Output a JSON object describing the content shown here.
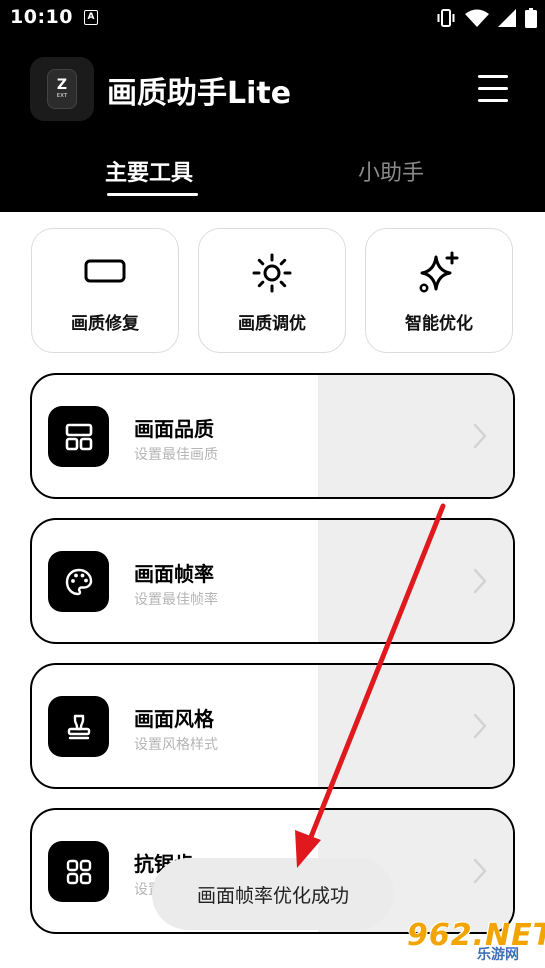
{
  "status_bar": {
    "time": "10:10",
    "notification_badge": "A",
    "icons": [
      "vibrate-icon",
      "wifi-icon",
      "signal-icon",
      "battery-icon"
    ]
  },
  "app": {
    "title": "画质助手Lite",
    "logo_letter": "Z",
    "logo_sub": "EXT"
  },
  "tabs": [
    {
      "label": "主要工具",
      "active": true
    },
    {
      "label": "小助手",
      "active": false
    }
  ],
  "quick_tools": [
    {
      "label": "画质修复",
      "icon": "rectangle-icon"
    },
    {
      "label": "画质调优",
      "icon": "sun-icon"
    },
    {
      "label": "智能优化",
      "icon": "sparkle-icon"
    }
  ],
  "features": [
    {
      "title": "画面品质",
      "subtitle": "设置最佳画质",
      "icon": "layout-grid-icon"
    },
    {
      "title": "画面帧率",
      "subtitle": "设置最佳帧率",
      "icon": "palette-icon"
    },
    {
      "title": "画面风格",
      "subtitle": "设置风格样式",
      "icon": "stamp-icon"
    },
    {
      "title": "抗锯齿",
      "subtitle": "设置抗锯齿",
      "icon": "apps-grid-icon"
    }
  ],
  "toast": "画面帧率优化成功",
  "watermark": {
    "main": "962.NET",
    "sub": "乐游网"
  },
  "colors": {
    "header_bg": "#000000",
    "active_tab": "#ffffff",
    "inactive_tab": "#8a8a8a",
    "annotation_arrow": "#e0191f",
    "row_shade": "#eeeeee",
    "subtitle_text": "#b5b5b5"
  }
}
